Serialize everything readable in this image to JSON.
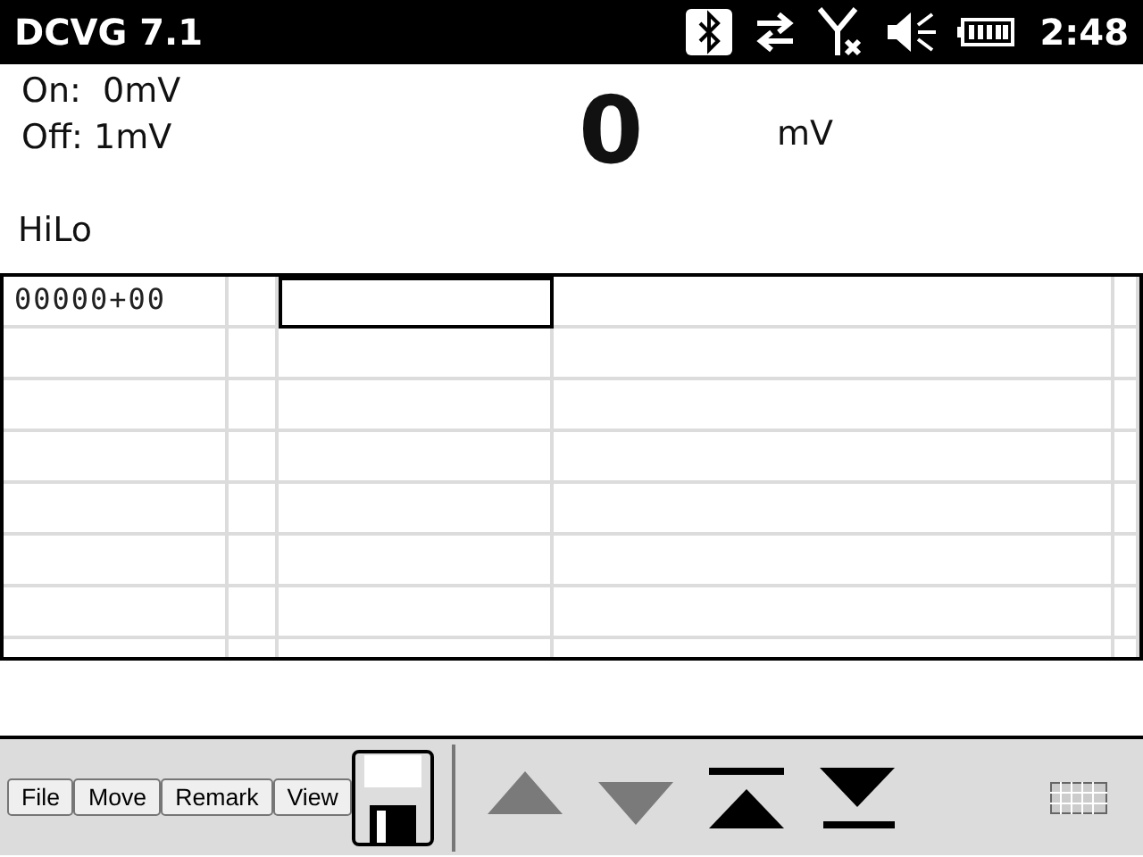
{
  "status_bar": {
    "title": "DCVG 7.1",
    "time": "2:48"
  },
  "readings": {
    "on": "On:  0mV",
    "off": "Off: 1mV",
    "value": "0",
    "unit": "mV",
    "mode": "HiLo"
  },
  "grid": {
    "rows": [
      {
        "cells": [
          {
            "text": "00000+00",
            "selected": false
          },
          {
            "selected": false
          },
          {
            "selected": true
          },
          {
            "selected": false
          },
          {
            "selected": false
          }
        ]
      },
      {
        "cells": [
          {
            "selected": false
          },
          {
            "selected": false
          },
          {
            "selected": false
          },
          {
            "selected": false
          },
          {
            "selected": false
          }
        ]
      },
      {
        "cells": [
          {
            "selected": false
          },
          {
            "selected": false
          },
          {
            "selected": false
          },
          {
            "selected": false
          },
          {
            "selected": false
          }
        ]
      },
      {
        "cells": [
          {
            "selected": false
          },
          {
            "selected": false
          },
          {
            "selected": false
          },
          {
            "selected": false
          },
          {
            "selected": false
          }
        ]
      },
      {
        "cells": [
          {
            "selected": false
          },
          {
            "selected": false
          },
          {
            "selected": false
          },
          {
            "selected": false
          },
          {
            "selected": false
          }
        ]
      },
      {
        "cells": [
          {
            "selected": false
          },
          {
            "selected": false
          },
          {
            "selected": false
          },
          {
            "selected": false
          },
          {
            "selected": false
          }
        ]
      },
      {
        "cells": [
          {
            "selected": false
          },
          {
            "selected": false
          },
          {
            "selected": false
          },
          {
            "selected": false
          },
          {
            "selected": false
          }
        ]
      },
      {
        "cells": [
          {
            "selected": false
          },
          {
            "selected": false
          },
          {
            "selected": false
          },
          {
            "selected": false
          },
          {
            "selected": false
          }
        ]
      }
    ]
  },
  "menu": [
    "File",
    "Move",
    "Remark",
    "View"
  ],
  "nav_buttons": [
    {
      "kind": "up",
      "disabled": true
    },
    {
      "kind": "down",
      "disabled": true
    },
    {
      "kind": "top",
      "disabled": false
    },
    {
      "kind": "bottom",
      "disabled": false
    }
  ]
}
